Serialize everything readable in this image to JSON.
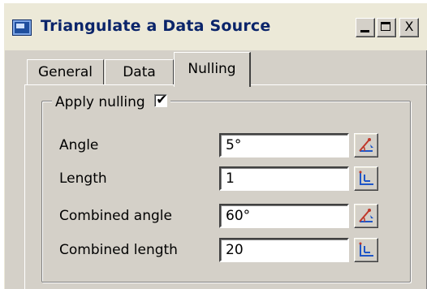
{
  "window": {
    "title": "Triangulate a Data Source",
    "minimize_glyph": "_",
    "maximize_glyph": "□",
    "close_glyph": "X"
  },
  "tabs": [
    {
      "label": "General",
      "selected": false
    },
    {
      "label": "Data",
      "selected": false
    },
    {
      "label": "Nulling",
      "selected": true
    }
  ],
  "nulling": {
    "group_label": "Apply nulling",
    "apply_checked": true,
    "check_glyph": "✔",
    "rows": [
      {
        "label": "Angle",
        "value": "5°",
        "picker_icon": "angle-picker-icon"
      },
      {
        "label": "Length",
        "value": "1",
        "picker_icon": "length-picker-icon"
      },
      {
        "label": "Combined angle",
        "value": "60°",
        "picker_icon": "angle-picker-icon"
      },
      {
        "label": "Combined length",
        "value": "20",
        "picker_icon": "length-picker-icon"
      }
    ]
  },
  "colors": {
    "face": "#d4d0c8",
    "title_text": "#0a246a",
    "icon_red": "#c0392b",
    "icon_blue": "#1f56c7"
  }
}
